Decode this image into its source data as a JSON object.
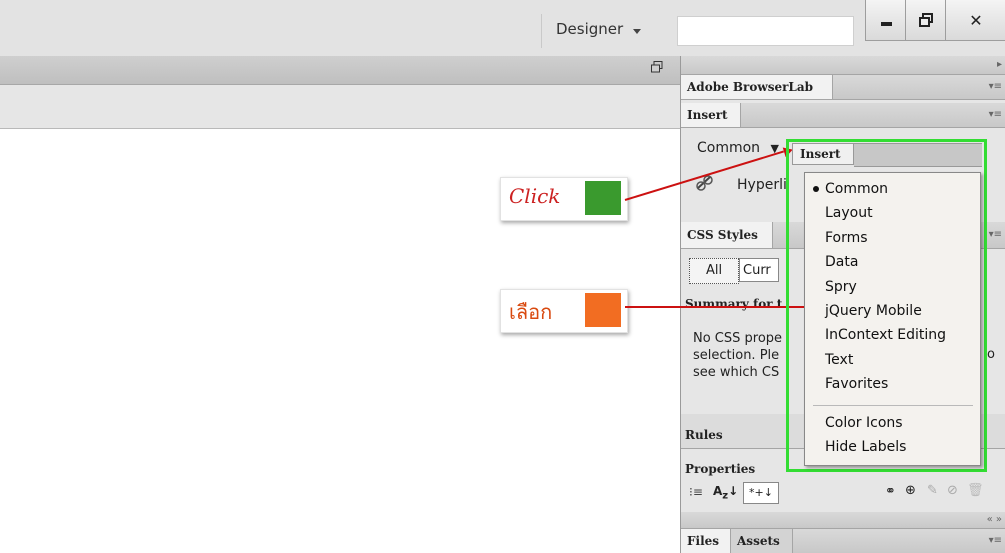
{
  "titlebar": {
    "workspace_label": "Designer",
    "search_placeholder": "",
    "minimize_icon": "minimize-icon",
    "restore_icon": "restore-icon",
    "close_icon": "close-icon"
  },
  "panel": {
    "browserlab_tab": "Adobe BrowserLab",
    "insert_tab": "Insert",
    "category_label": "Common",
    "hyperlink_label": "Hyperli",
    "css_styles_tab": "CSS Styles",
    "all_button": "All",
    "current_button": "Curr",
    "summary_label": "Summary for t",
    "summary_text": [
      "No CSS prope",
      "selection.  Ple",
      "see which CS"
    ],
    "summary_text_right": "o",
    "rules_label": "Rules",
    "properties_label": "Properties",
    "files_tab": "Files",
    "assets_tab": "Assets"
  },
  "callouts": {
    "click_label": "Click",
    "click_color": "#3a9a2e",
    "select_label": "เลือก",
    "select_color": "#f26d22"
  },
  "menu": {
    "header_tab": "Insert",
    "items": [
      "Common",
      "Layout",
      "Forms",
      "Data",
      "Spry",
      "jQuery Mobile",
      "InContext Editing",
      "Text",
      "Favorites"
    ],
    "selected_index": 0,
    "extra_items": [
      "Color Icons",
      "Hide Labels"
    ],
    "highlight_color": "#33dd33"
  }
}
